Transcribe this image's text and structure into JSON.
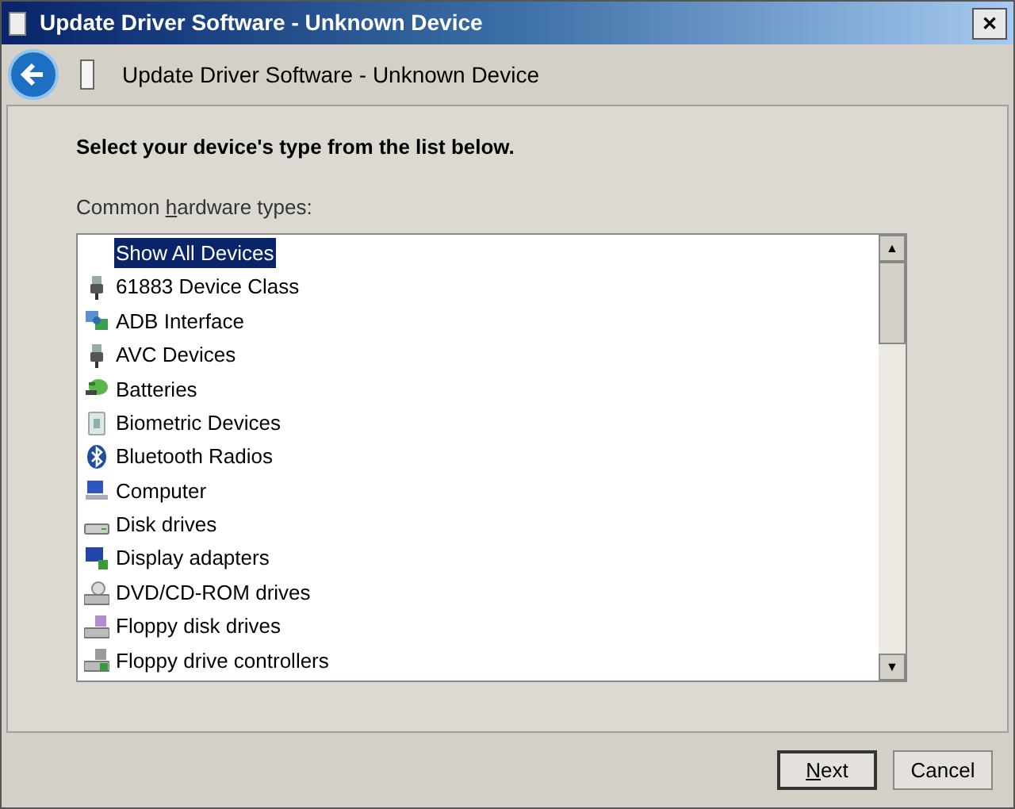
{
  "window": {
    "title": "Update Driver Software - Unknown Device",
    "close": "✕"
  },
  "header": {
    "title": "Update Driver Software - Unknown Device"
  },
  "instruction": "Select your device's type from the list below.",
  "list_label": {
    "before": "Common ",
    "accelerator": "h",
    "after": "ardware types:"
  },
  "devices": [
    {
      "label": "Show All Devices",
      "kind": "blank",
      "selected": true
    },
    {
      "label": "61883 Device Class",
      "kind": "plug",
      "selected": false
    },
    {
      "label": "ADB Interface",
      "kind": "network",
      "selected": false
    },
    {
      "label": "AVC Devices",
      "kind": "plug",
      "selected": false
    },
    {
      "label": "Batteries",
      "kind": "battery",
      "selected": false
    },
    {
      "label": "Biometric Devices",
      "kind": "biometric",
      "selected": false
    },
    {
      "label": "Bluetooth Radios",
      "kind": "bluetooth",
      "selected": false
    },
    {
      "label": "Computer",
      "kind": "computer",
      "selected": false
    },
    {
      "label": "Disk drives",
      "kind": "disk",
      "selected": false
    },
    {
      "label": "Display adapters",
      "kind": "display",
      "selected": false
    },
    {
      "label": "DVD/CD-ROM drives",
      "kind": "dvd",
      "selected": false
    },
    {
      "label": "Floppy disk drives",
      "kind": "floppy",
      "selected": false
    },
    {
      "label": "Floppy drive controllers",
      "kind": "controller",
      "selected": false
    }
  ],
  "scroll_up": "▲",
  "scroll_down": "▼",
  "buttons": [
    {
      "accelerator": "N",
      "rest": "ext",
      "kind": "default"
    },
    {
      "rest": "Cancel",
      "kind": "normal"
    }
  ]
}
